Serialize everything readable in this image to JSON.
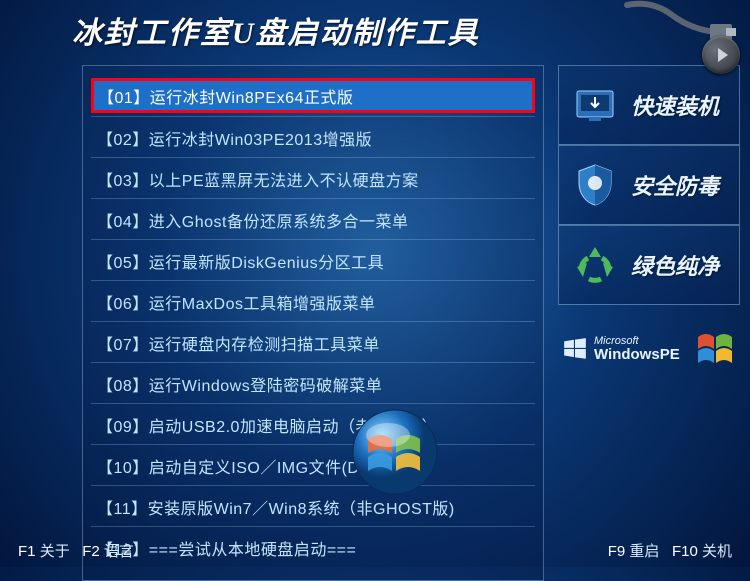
{
  "title": "冰封工作室U盘启动制作工具",
  "menu": {
    "items": [
      {
        "label": "【01】运行冰封Win8PEx64正式版",
        "selected": true
      },
      {
        "label": "【02】运行冰封Win03PE2013增强版"
      },
      {
        "label": "【03】以上PE蓝黑屏无法进入不认硬盘方案"
      },
      {
        "label": "【04】进入Ghost备份还原系统多合一菜单"
      },
      {
        "label": "【05】运行最新版DiskGenius分区工具"
      },
      {
        "label": "【06】运行MaxDos工具箱增强版菜单"
      },
      {
        "label": "【07】运行硬盘内存检测扫描工具菜单"
      },
      {
        "label": "【08】运行Windows登陆密码破解菜单"
      },
      {
        "label": "【09】启动USB2.0加速电脑启动（老机专用）"
      },
      {
        "label": "【10】启动自定义ISO／IMG文件(DND目录）"
      },
      {
        "label": "【11】安装原版Win7／Win8系统（非GHOST版)"
      },
      {
        "label": "【12】===尝试从本地硬盘启动==="
      }
    ]
  },
  "badges": [
    {
      "label": "快速装机",
      "icon": "install"
    },
    {
      "label": "安全防毒",
      "icon": "shield"
    },
    {
      "label": "绿色纯净",
      "icon": "recycle"
    }
  ],
  "winpe": {
    "line1": "Microsoft",
    "line2": "WindowsPE"
  },
  "footer": {
    "f1_key": "F1",
    "f1_label": "关于",
    "f2_key": "F2",
    "f2_label": "语言",
    "f9_key": "F9",
    "f9_label": "重启",
    "f10_key": "F10",
    "f10_label": "关机"
  }
}
